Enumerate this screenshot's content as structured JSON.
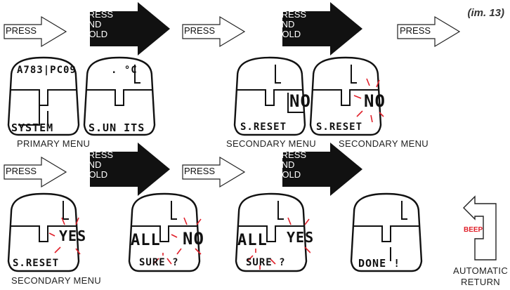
{
  "figure_ref": "(im. 13)",
  "arrows": {
    "press": "PRESS",
    "press_hold_line1": "PRESS",
    "press_hold_line2": "AND",
    "press_hold_line3": "HOLD"
  },
  "beep": "BEEP",
  "captions": {
    "primary": "PRIMARY MENU",
    "secondary": "SECONDARY MENU",
    "auto_line1": "AUTOMATIC",
    "auto_line2": "RETURN"
  },
  "screens": [
    {
      "top": "A783|PC09",
      "bottom": "SYSTEM"
    },
    {
      "top": ". °C",
      "bottom": "S.UN ITS"
    },
    {
      "value": "NO",
      "bottom": "S.RESET"
    },
    {
      "value": "NO",
      "bottom": "S.RESET"
    },
    {
      "value": "YES",
      "bottom": "S.RESET"
    },
    {
      "left": "ALL",
      "value": "NO",
      "bottom": "SURE ?"
    },
    {
      "left": "ALL",
      "value": "YES",
      "bottom": "SURE ?"
    },
    {
      "bottom": "DONE !"
    }
  ]
}
